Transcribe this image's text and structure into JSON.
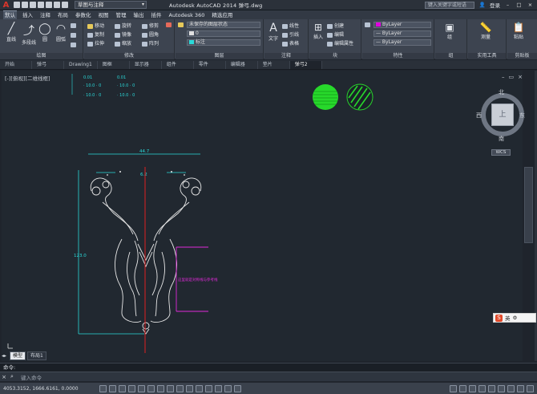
{
  "titlebar": {
    "logo": "A",
    "workspace": "草图与注释",
    "app_title": "Autodesk AutoCAD 2014    弹弓.dwg",
    "search_placeholder": "键入关键字或短语",
    "login": "登录"
  },
  "tabs": [
    "默认",
    "插入",
    "注释",
    "布局",
    "参数化",
    "视图",
    "管理",
    "输出",
    "插件",
    "Autodesk 360",
    "精选应用"
  ],
  "ribbon": {
    "draw": {
      "label": "绘图",
      "line": "直线",
      "polyline": "多段线",
      "circle": "圆",
      "arc": "圆弧"
    },
    "modify": {
      "label": "修改",
      "move": "移动",
      "rotate": "旋转",
      "trim": "修剪",
      "copy": "复制",
      "mirror": "镜像",
      "fillet": "圆角",
      "stretch": "拉伸",
      "scale": "缩放",
      "array": "阵列"
    },
    "layers": {
      "label": "图层",
      "layer_state": "未保存的图层状态",
      "layer_name": "0",
      "current": "标注"
    },
    "annotation": {
      "label": "注释",
      "text": "文字",
      "dim": "线性",
      "leader": "引线",
      "table": "表格"
    },
    "block": {
      "label": "块",
      "insert": "插入",
      "create": "创建",
      "edit": "编辑",
      "attr": "编辑属性"
    },
    "properties": {
      "label": "特性",
      "color": "ByLayer",
      "linetype": "ByLayer",
      "lineweight": "ByLayer"
    },
    "groups": {
      "label": "组",
      "group": "组"
    },
    "utilities": {
      "label": "实用工具",
      "measure": "测量"
    },
    "clipboard": {
      "label": "剪贴板",
      "paste": "粘贴"
    }
  },
  "filetabs": [
    "开始",
    "弹弓",
    "Drawing1",
    "图框",
    "显示器",
    "组件",
    "零件",
    "编辑器",
    "垫片",
    "弹弓2"
  ],
  "viewport": {
    "label": "[-][俯视][二维线框]",
    "dims_top": [
      "0.01",
      "0.01"
    ],
    "dim_labels": [
      "44.7",
      "6.2",
      "123.0",
      "R10"
    ],
    "pink_label": "这里就是对称线与参考线"
  },
  "viewcube": {
    "north": "北",
    "south": "南",
    "east": "东",
    "west": "西",
    "top": "上",
    "wcs": "WCS"
  },
  "ime": {
    "label": "英"
  },
  "layout_tabs": [
    "模型",
    "布局1"
  ],
  "command": {
    "history": "命令:",
    "placeholder": "键入命令"
  },
  "status": {
    "coords": "4053.3152, 1666.6161, 0.0000"
  }
}
